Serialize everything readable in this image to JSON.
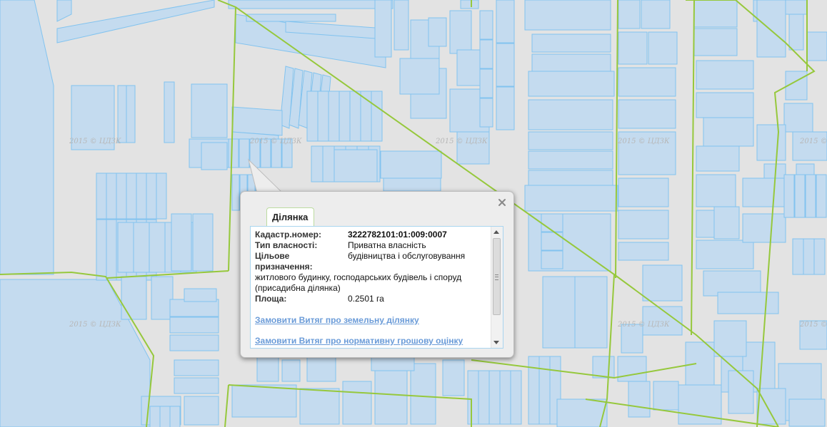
{
  "map": {
    "watermark": "2015 © ЦДЗК",
    "colors": {
      "background": "#e3e3e3",
      "parcel_fill": "#c4dbef",
      "parcel_stroke": "#82c3ef",
      "boundary": "#96c83c"
    }
  },
  "popup": {
    "tab_label": "Ділянка",
    "close_icon": "close-icon",
    "fields": {
      "cadastral_label": "Кадастр.номер:",
      "cadastral_value": "3222782101:01:009:0007",
      "ownership_label": "Тип власності:",
      "ownership_value": "Приватна власність",
      "purpose_label": "Цільове призначення:",
      "purpose_value_1": "будівництва і обслуговування",
      "purpose_value_2": "житлового будинку, господарських будівель і споруд",
      "purpose_value_3": "(присадибна ділянка)",
      "area_label": "Площа:",
      "area_value": "0.2501 га"
    },
    "links": {
      "extract_land": "Замовити Витяг про земельну ділянку",
      "extract_valuation": "Замовити Витяг про нормативну грошову оцінку"
    }
  }
}
